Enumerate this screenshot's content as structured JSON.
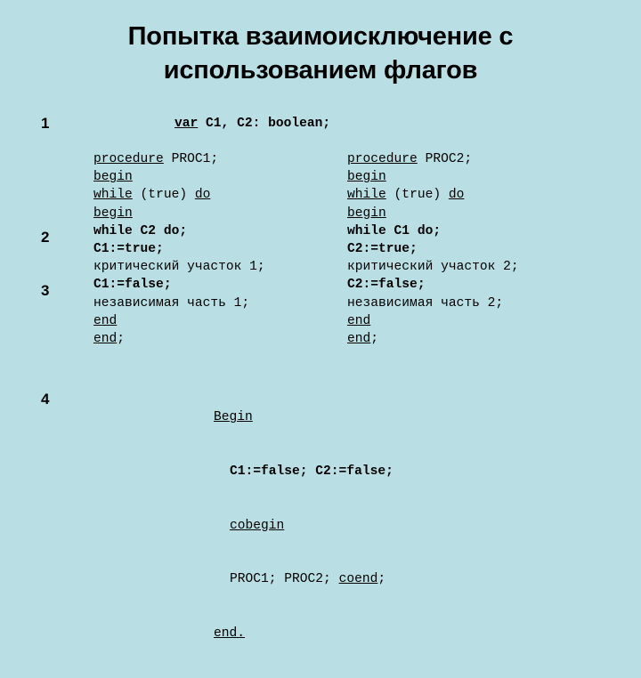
{
  "slide": {
    "background_color": "#b9dfe4",
    "text_color": "#000000",
    "title": "Попытка взаимоисключение с использованием флагов"
  },
  "line_numbers": {
    "n1": "1",
    "n2": "2",
    "n3": "3",
    "n4": "4"
  },
  "declaration": {
    "keyword": "var",
    "rest": " C1, C2: boolean;"
  },
  "proc_left": {
    "lines": [
      {
        "keyword": "procedure",
        "rest": " PROC1;",
        "bold": false
      },
      {
        "keyword": "begin",
        "rest": "",
        "bold": false
      },
      {
        "keyword": "while",
        "rest": " (true) ",
        "keyword2": "do",
        "bold": false
      },
      {
        "keyword": "begin",
        "rest": "",
        "bold": false
      },
      {
        "keyword": "",
        "rest": "while C2 do;",
        "bold": true
      },
      {
        "keyword": "",
        "rest": "C1:=true;",
        "bold": true
      },
      {
        "keyword": "",
        "rest": "критический участок 1;",
        "bold": false
      },
      {
        "keyword": "",
        "rest": "C1:=false;",
        "bold": true
      },
      {
        "keyword": "",
        "rest": "независимая часть 1;",
        "bold": false
      },
      {
        "keyword": "end",
        "rest": "",
        "bold": false
      },
      {
        "keyword": "end",
        "rest": ";",
        "bold": false
      }
    ]
  },
  "proc_right": {
    "lines": [
      {
        "keyword": "procedure",
        "rest": " PROC2;",
        "bold": false
      },
      {
        "keyword": "begin",
        "rest": "",
        "bold": false
      },
      {
        "keyword": "while",
        "rest": " (true) ",
        "keyword2": "do",
        "bold": false
      },
      {
        "keyword": "begin",
        "rest": "",
        "bold": false
      },
      {
        "keyword": "",
        "rest": "while C1 do;",
        "bold": true
      },
      {
        "keyword": "",
        "rest": "C2:=true;",
        "bold": true
      },
      {
        "keyword": "",
        "rest": "критический участок 2;",
        "bold": false
      },
      {
        "keyword": "",
        "rest": "C2:=false;",
        "bold": true
      },
      {
        "keyword": "",
        "rest": "независимая часть 2;",
        "bold": false
      },
      {
        "keyword": "end",
        "rest": "",
        "bold": false
      },
      {
        "keyword": "end",
        "rest": ";",
        "bold": false
      }
    ]
  },
  "main_block": {
    "begin": "Begin",
    "assign": "C1:=false; C2:=false;",
    "cobegin": "cobegin",
    "calls_pre": "PROC1; PROC2; ",
    "coend": "coend",
    "calls_post": ";",
    "end": "end."
  }
}
